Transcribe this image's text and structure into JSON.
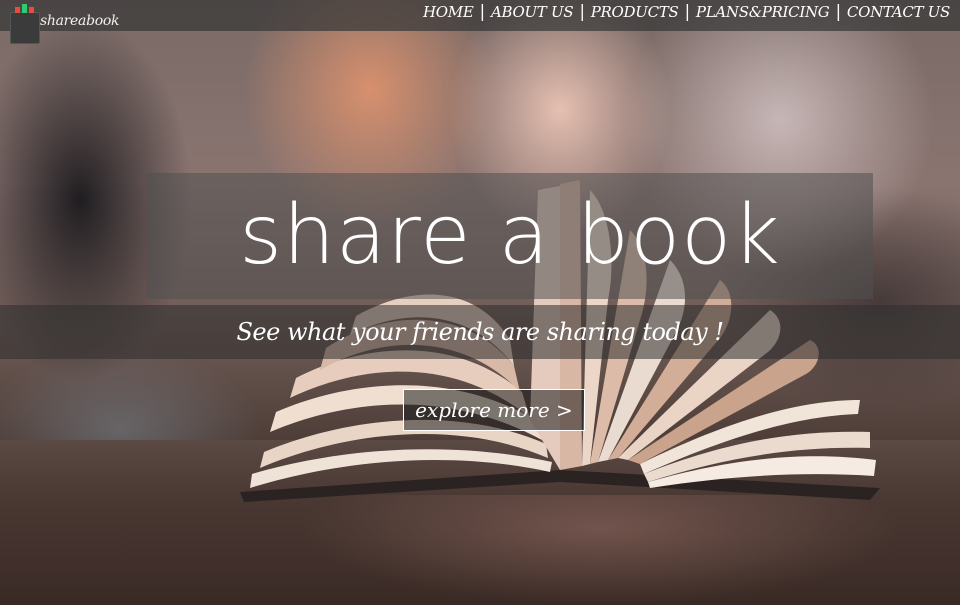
{
  "brand": {
    "name": "shareabook",
    "bar_colors": [
      "#e74c3c",
      "#2ecc71",
      "#e74c3c"
    ]
  },
  "nav": {
    "items": [
      {
        "label": "HOME"
      },
      {
        "label": "ABOUT US"
      },
      {
        "label": "PRODUCTS"
      },
      {
        "label": "PLANS&PRICING"
      },
      {
        "label": "CONTACT US"
      }
    ],
    "separator": "|"
  },
  "hero": {
    "title": "share a book",
    "subtitle": "See what your friends are sharing today !",
    "cta_label": "explore more >",
    "image_subject": "open-book-icon"
  },
  "colors": {
    "navbar_bg": "#373737",
    "text": "#ffffff"
  }
}
